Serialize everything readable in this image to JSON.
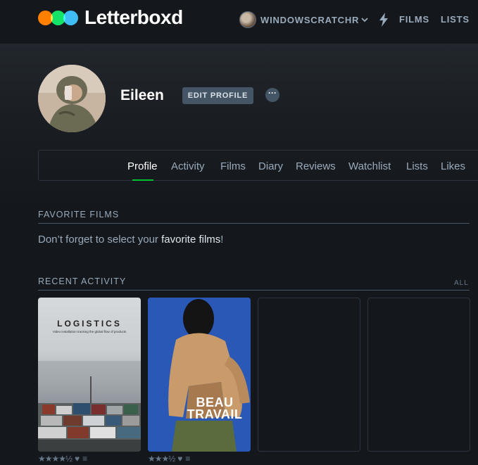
{
  "header": {
    "app_name": "Letterboxd",
    "username": "WINDOWSCRATCHR",
    "nav_films": "FILMS",
    "nav_lists": "LISTS"
  },
  "profile": {
    "name": "Eileen",
    "edit_button": "EDIT PROFILE",
    "more_button": "···"
  },
  "tabs": [
    "Profile",
    "Activity",
    "Films",
    "Diary",
    "Reviews",
    "Watchlist",
    "Lists",
    "Likes"
  ],
  "active_tab": "Profile",
  "favorites": {
    "heading": "FAVORITE FILMS",
    "text_before": "Don’t forget to select your ",
    "link": "favorite films",
    "text_after": "!"
  },
  "recent": {
    "heading": "RECENT ACTIVITY",
    "all_link": "ALL",
    "items": [
      {
        "poster_title": "LOGISTICS",
        "poster_subtitle": "Video installation tracking the global flow of products",
        "stars": "★★★★½",
        "liked_icon": "heart-icon",
        "review_icon": "review-lines-icon"
      },
      {
        "poster_title": "BEAU TRAVAIL",
        "stars": "★★★½",
        "liked_icon": "heart-icon",
        "review_icon": "review-lines-icon"
      }
    ],
    "empty_slots": 2
  },
  "colors": {
    "background": "#14181c",
    "text": "#99aabb",
    "accent_green": "#00c030",
    "logo_orange": "#ff8000",
    "logo_green": "#00e054",
    "logo_blue": "#40bcf4",
    "button": "#445566"
  }
}
